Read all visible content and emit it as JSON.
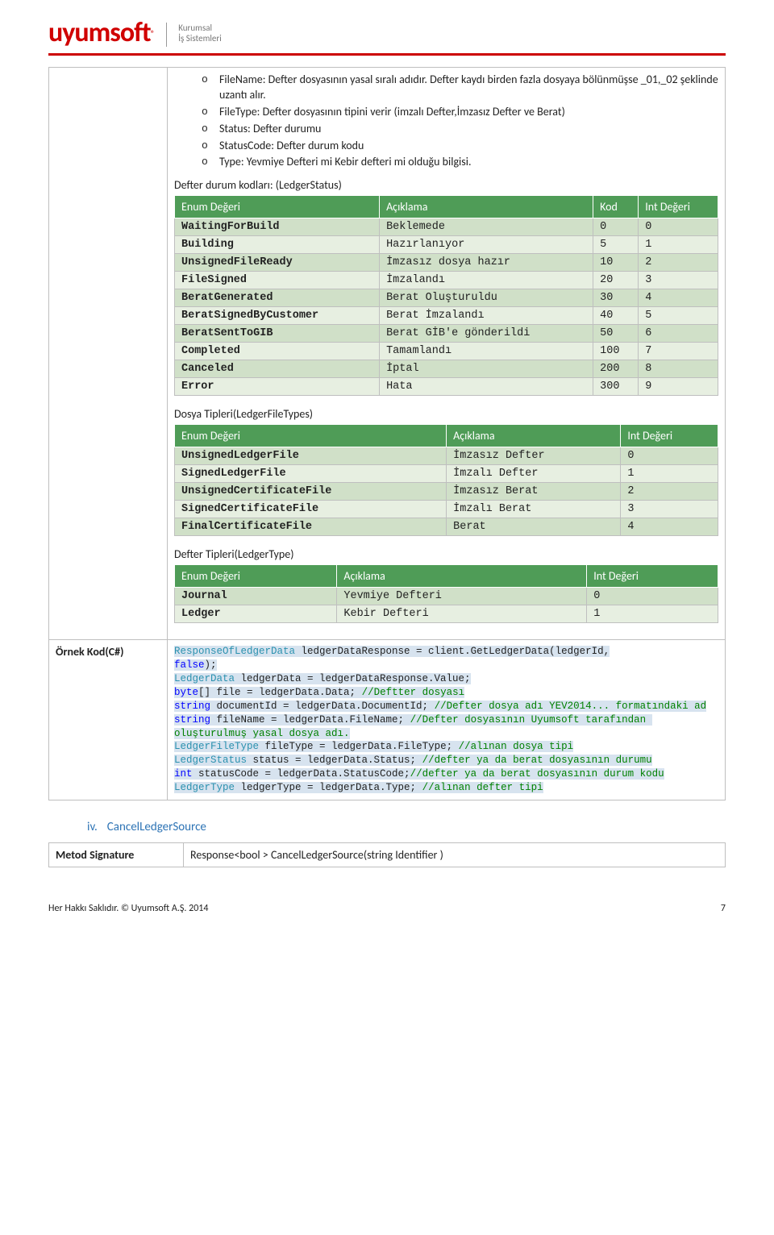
{
  "logo": {
    "brand": "uyumsoft",
    "tagline1": "Kurumsal",
    "tagline2": "İş Sistemleri"
  },
  "bullets": [
    "FileName: Defter dosyasının yasal sıralı adıdır. Defter kaydı birden fazla dosyaya bölünmüşse _01,_02 şeklinde uzantı alır.",
    "FileType: Defter dosyasının tipini verir (imzalı Defter,İmzasız Defter ve Berat)",
    "Status: Defter durumu",
    "StatusCode: Defter durum kodu",
    "Type: Yevmiye Defteri  mi Kebir defteri mi olduğu bilgisi."
  ],
  "defterDurum": {
    "title": "Defter durum kodları: (LedgerStatus)",
    "headers": [
      "Enum Değeri",
      "Açıklama",
      "Kod",
      "Int Değeri"
    ],
    "rows": [
      [
        "WaitingForBuild",
        "Beklemede",
        "0",
        "0"
      ],
      [
        "Building",
        "Hazırlanıyor",
        "5",
        "1"
      ],
      [
        "UnsignedFileReady",
        "İmzasız dosya hazır",
        "10",
        "2"
      ],
      [
        "FileSigned",
        "İmzalandı",
        "20",
        "3"
      ],
      [
        "BeratGenerated",
        "Berat Oluşturuldu",
        "30",
        "4"
      ],
      [
        "BeratSignedByCustomer",
        "Berat İmzalandı",
        "40",
        "5"
      ],
      [
        "BeratSentToGIB",
        "Berat GİB'e gönderildi",
        "50",
        "6"
      ],
      [
        "Completed",
        "Tamamlandı",
        "100",
        "7"
      ],
      [
        "Canceled",
        "İptal",
        "200",
        "8"
      ],
      [
        "Error",
        "Hata",
        "300",
        "9"
      ]
    ]
  },
  "fileTypes": {
    "title": "Dosya Tipleri(LedgerFileTypes)",
    "headers": [
      "Enum Değeri",
      "Açıklama",
      "Int Değeri"
    ],
    "rows": [
      [
        "UnsignedLedgerFile",
        "İmzasız Defter",
        "0"
      ],
      [
        "SignedLedgerFile",
        "İmzalı Defter",
        "1"
      ],
      [
        "UnsignedCertificateFile",
        "İmzasız Berat",
        "2"
      ],
      [
        "SignedCertificateFile",
        "İmzalı Berat",
        "3"
      ],
      [
        "FinalCertificateFile",
        "Berat",
        "4"
      ]
    ]
  },
  "ledgerType": {
    "title": "Defter Tipleri(LedgerType)",
    "headers": [
      "Enum Değeri",
      "Açıklama",
      "Int Değeri"
    ],
    "rows": [
      [
        "Journal",
        "Yevmiye Defteri",
        "0"
      ],
      [
        "Ledger",
        "Kebir Defteri",
        "1"
      ]
    ]
  },
  "codeLabel": "Örnek Kod(C#)",
  "code": {
    "l1a": "ResponseOfLedgerData",
    "l1b": " ledgerDataResponse = client.GetLedgerData(ledgerId,",
    "l2a": "false",
    "l2b": ");",
    "l3a": "LedgerData",
    "l3b": " ledgerData = ledgerDataResponse.Value;",
    "l4a": "byte",
    "l4b": "[] file = ledgerData.Data; ",
    "l4c": "//Deftter dosyası",
    "l5a": "string",
    "l5b": " documentId = ledgerData.DocumentId; ",
    "l5c": "//Defter dosya adı YEV2014... formatındaki ad",
    "l6a": "string",
    "l6b": " fileName = ledgerData.FileName; ",
    "l6c": "//Defter dosyasının Uyumsoft tarafından oluşturulmuş yasal dosya adı.",
    "l7a": "LedgerFileType",
    "l7b": " fileType = ledgerData.FileType; ",
    "l7c": "//alınan dosya tipi",
    "l8a": "LedgerStatus",
    "l8b": " status = ledgerData.Status; ",
    "l8c": "//defter ya da berat dosyasının durumu",
    "l9a": "int",
    "l9b": " statusCode = ledgerData.StatusCode;",
    "l9c": "//defter ya da berat dosyasının durum kodu",
    "l10a": "LedgerType",
    "l10b": " ledgerType = ledgerData.Type; ",
    "l10c": "//alınan defter tipi"
  },
  "section": {
    "roman": "iv.",
    "name": "CancelLedgerSource"
  },
  "method": {
    "label": "Metod Signature",
    "value": "Response<bool > CancelLedgerSource(string Identifier )"
  },
  "footer": {
    "left": "Her Hakkı Saklıdır. © Uyumsoft A.Ş.  2014",
    "right": "7"
  }
}
